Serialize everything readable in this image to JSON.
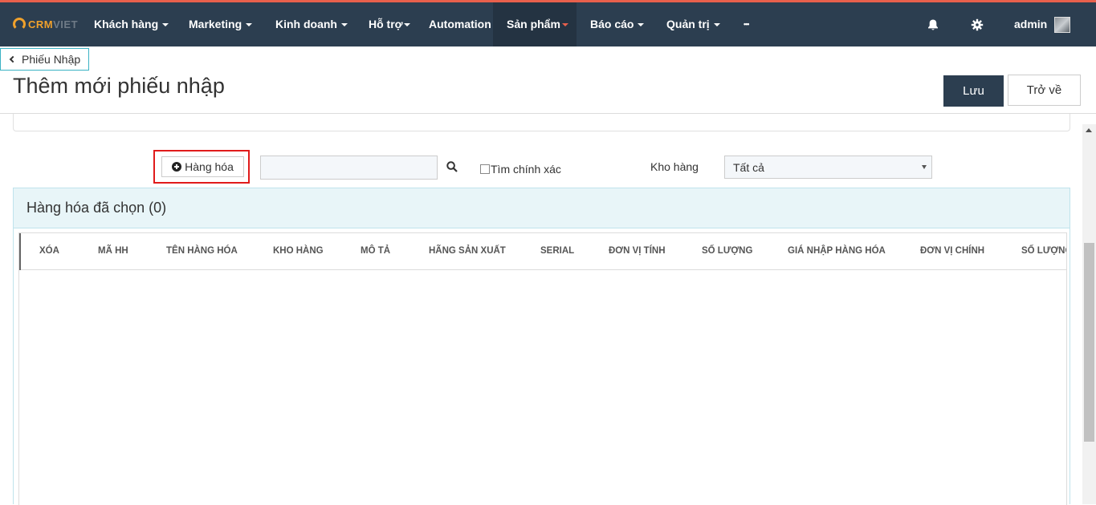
{
  "navbar": {
    "logo": {
      "part1": "CRM",
      "part2": "VIET"
    },
    "items": [
      {
        "label": "Khách hàng",
        "caret": true
      },
      {
        "label": "Marketing",
        "caret": true
      },
      {
        "label": "Kinh doanh",
        "caret": true
      },
      {
        "label": "Hỗ trợ",
        "caret": true
      },
      {
        "label": "Automation",
        "caret": false
      },
      {
        "label": "Sản phẩm",
        "caret": true,
        "active": true
      },
      {
        "label": "Báo cáo",
        "caret": true
      },
      {
        "label": "Quản trị",
        "caret": true
      }
    ],
    "more_label": "•••",
    "user_label": "admin",
    "icons": [
      "bell-icon",
      "gear-icon"
    ]
  },
  "page": {
    "back_label": "Phiếu Nhập",
    "title": "Thêm mới phiếu nhập",
    "save_label": "Lưu",
    "return_label": "Trở về"
  },
  "toolbar": {
    "add_goods_label": "Hàng hóa",
    "search_value": "",
    "exact_label": "Tìm chính xác",
    "warehouse_label": "Kho hàng",
    "warehouse_selected": "Tất cả"
  },
  "selected_goods": {
    "heading": "Hàng hóa đã chọn (0)",
    "columns": [
      "XÓA",
      "MÃ HH",
      "TÊN HÀNG HÓA",
      "KHO HÀNG",
      "MÔ TẢ",
      "HÃNG SẢN XUẤT",
      "SERIAL",
      "ĐƠN VỊ TÍNH",
      "SỐ LƯỢNG",
      "GIÁ NHẬP HÀNG HÓA",
      "ĐƠN VỊ CHÍNH",
      "SỐ LƯỢNG"
    ],
    "rows": []
  },
  "colors": {
    "navbar_bg": "#2c3e50",
    "navbar_accent": "#e8604c",
    "logo_orange": "#f0a12c",
    "panel_head_bg": "#e8f5f8",
    "highlight_red": "#e01b1b"
  }
}
